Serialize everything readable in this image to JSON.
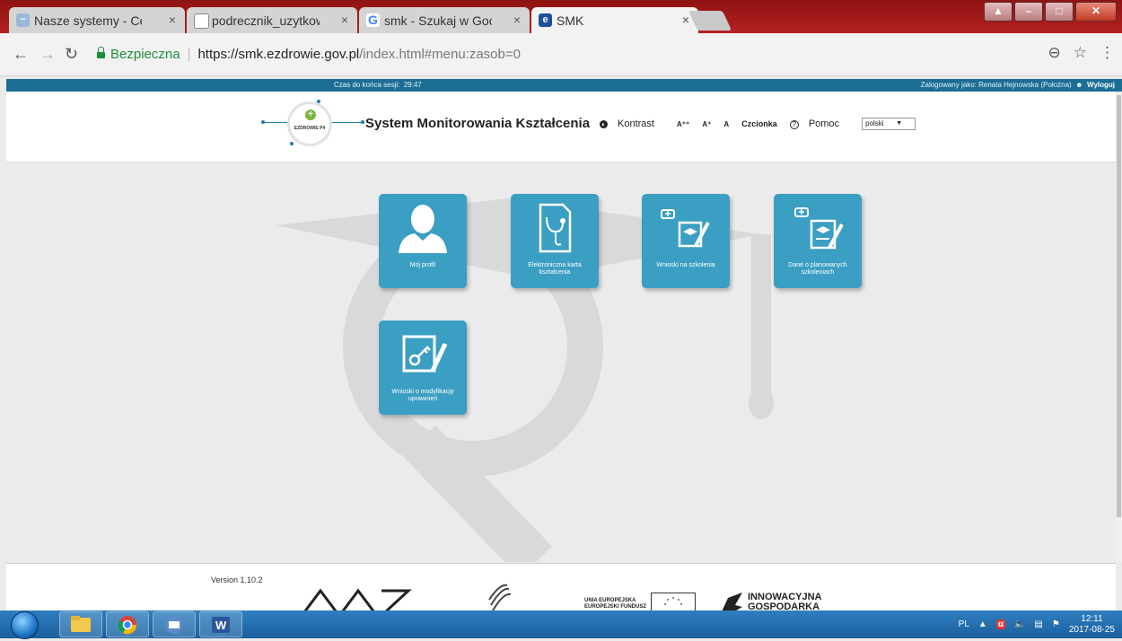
{
  "browser": {
    "tabs": [
      {
        "title": "Nasze systemy - Centrum",
        "active": false
      },
      {
        "title": "podrecznik_uzytkownika",
        "active": false
      },
      {
        "title": "smk - Szukaj w Google",
        "active": false
      },
      {
        "title": "SMK",
        "active": true
      }
    ],
    "close_glyph": "×",
    "address": {
      "secure_label": "Bezpieczna",
      "url_host": "https://smk.ezdrowie.gov.pl",
      "url_path": "/index.html#menu:zasob=0"
    }
  },
  "site": {
    "session_label": "Czas do końca sesji:",
    "session_time": "29:47",
    "logged_in_label": "Zalogowany jako: Renata Hejnowska (Położna)",
    "logout_label": "Wyloguj",
    "logo_text": "EZDROWIE P4",
    "title": "System Monitorowania Kształcenia",
    "contrast_label": "Kontrast",
    "font_a3": "A⁺⁺",
    "font_a2": "A⁺",
    "font_a1": "A",
    "font_label": "Czcionka",
    "help_label": "Pomoc",
    "language": "polski"
  },
  "tiles": [
    {
      "label": "Mój profil",
      "icon": "user-icon"
    },
    {
      "label": "Elektroniczna karta kształcenia",
      "icon": "medical-card-icon"
    },
    {
      "label": "Wnioski na szkolenia",
      "icon": "training-application-icon"
    },
    {
      "label": "Dane o planowanych szkoleniach",
      "icon": "planned-training-icon"
    },
    {
      "label": "Wnioski o modyfikację uprawnień",
      "icon": "permission-key-icon"
    }
  ],
  "footer": {
    "version": "Version 1.10.2",
    "eu_line1": "UNIA EUROPEJSKA",
    "eu_line2": "EUROPEJSKI FUNDUSZ",
    "innov_line1": "INNOWACYJNA",
    "innov_line2": "GOSPODARKA"
  },
  "taskbar": {
    "lang": "PL",
    "time": "12:11",
    "date": "2017-08-25"
  },
  "colors": {
    "tile": "#3b9ec3",
    "sitebar": "#1b6d94",
    "chrome_frame": "#b52020"
  }
}
